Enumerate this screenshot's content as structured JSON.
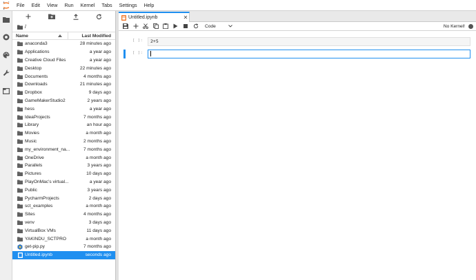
{
  "menubar": {
    "items": [
      "File",
      "Edit",
      "View",
      "Run",
      "Kernel",
      "Tabs",
      "Settings",
      "Help"
    ]
  },
  "leftbar": {
    "icons": [
      "folder-icon",
      "running-icon",
      "palette-icon",
      "wrench-icon",
      "tab-icon"
    ]
  },
  "filebrowser": {
    "breadcrumb": "/",
    "columns": {
      "name": "Name",
      "modified": "Last Modified"
    },
    "rows": [
      {
        "name": "anaconda3",
        "modified": "28 minutes ago",
        "type": "folder"
      },
      {
        "name": "Applications",
        "modified": "a year ago",
        "type": "folder"
      },
      {
        "name": "Creative Cloud Files",
        "modified": "a year ago",
        "type": "folder"
      },
      {
        "name": "Desktop",
        "modified": "22 minutes ago",
        "type": "folder"
      },
      {
        "name": "Documents",
        "modified": "4 months ago",
        "type": "folder"
      },
      {
        "name": "Downloads",
        "modified": "21 minutes ago",
        "type": "folder"
      },
      {
        "name": "Dropbox",
        "modified": "9 days ago",
        "type": "folder"
      },
      {
        "name": "GameMakerStudio2",
        "modified": "2 years ago",
        "type": "folder"
      },
      {
        "name": "hess",
        "modified": "a year ago",
        "type": "folder"
      },
      {
        "name": "IdeaProjects",
        "modified": "7 months ago",
        "type": "folder"
      },
      {
        "name": "Library",
        "modified": "an hour ago",
        "type": "folder"
      },
      {
        "name": "Movies",
        "modified": "a month ago",
        "type": "folder"
      },
      {
        "name": "Music",
        "modified": "2 months ago",
        "type": "folder"
      },
      {
        "name": "my_environment_na...",
        "modified": "7 months ago",
        "type": "folder"
      },
      {
        "name": "OneDrive",
        "modified": "a month ago",
        "type": "folder"
      },
      {
        "name": "Parallels",
        "modified": "3 years ago",
        "type": "folder"
      },
      {
        "name": "Pictures",
        "modified": "10 days ago",
        "type": "folder"
      },
      {
        "name": "PlayOnMac's virtual...",
        "modified": "a year ago",
        "type": "folder"
      },
      {
        "name": "Public",
        "modified": "3 years ago",
        "type": "folder"
      },
      {
        "name": "PycharmProjects",
        "modified": "2 days ago",
        "type": "folder"
      },
      {
        "name": "sct_examples",
        "modified": "a month ago",
        "type": "folder"
      },
      {
        "name": "Sites",
        "modified": "4 months ago",
        "type": "folder"
      },
      {
        "name": "venv",
        "modified": "3 days ago",
        "type": "folder"
      },
      {
        "name": "VirtualBox VMs",
        "modified": "11 days ago",
        "type": "folder"
      },
      {
        "name": "YAKINDU_SCTPRO",
        "modified": "a month ago",
        "type": "folder"
      },
      {
        "name": "get-pip.py",
        "modified": "7 months ago",
        "type": "python"
      },
      {
        "name": "Untitled.ipynb",
        "modified": "seconds ago",
        "type": "notebook",
        "selected": true
      }
    ]
  },
  "notebook": {
    "tab_title": "Untitled.ipynb",
    "cell_type": "Code",
    "kernel_status": "No Kernel!",
    "cells": [
      {
        "prompt": "[ ]:",
        "source": "2+5",
        "active": false
      },
      {
        "prompt": "[ ]:",
        "source": "",
        "active": true
      }
    ]
  },
  "colors": {
    "accent": "#1f8ff0",
    "folder": "#616161",
    "python": "#3b7bbf",
    "notebook": "#f37726"
  }
}
